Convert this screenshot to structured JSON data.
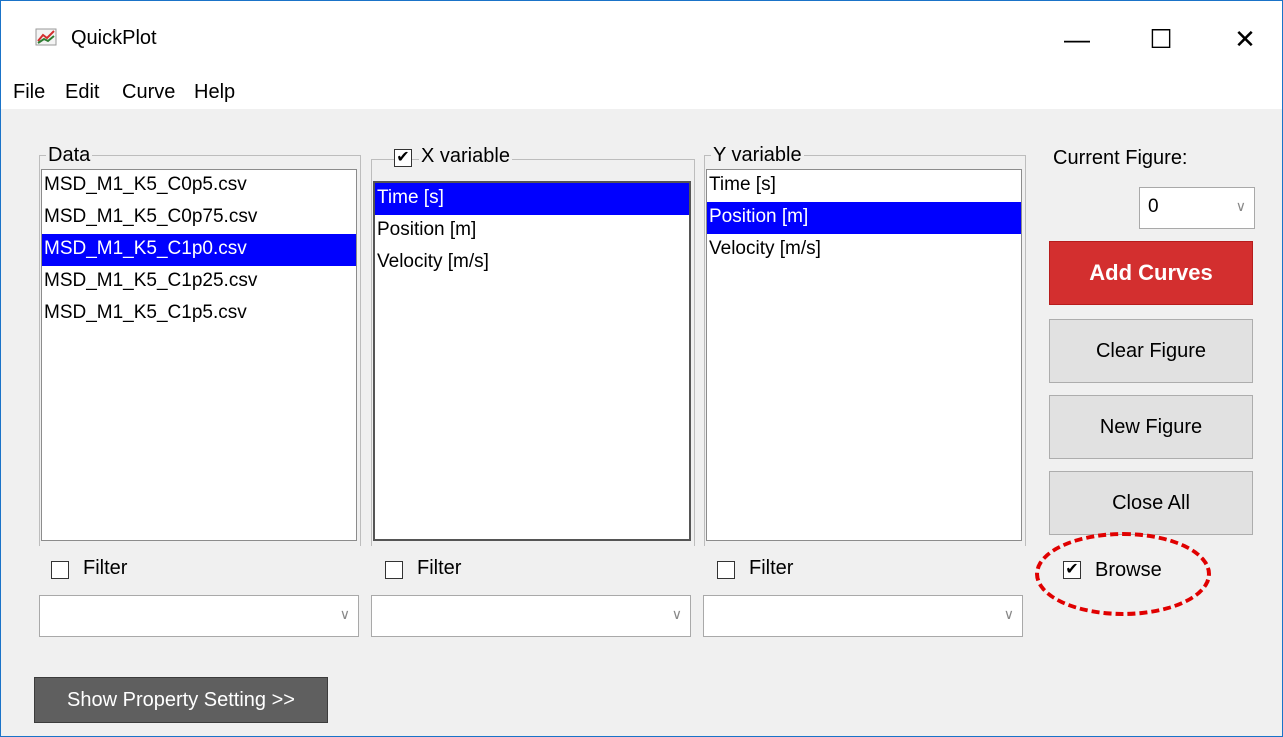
{
  "window": {
    "title": "QuickPlot",
    "controls": {
      "minimize": "—",
      "maximize": "☐",
      "close": "✕"
    }
  },
  "menu": [
    "File",
    "Edit",
    "Curve",
    "Help"
  ],
  "panels": {
    "data": {
      "label": "Data",
      "items": [
        "MSD_M1_K5_C0p5.csv",
        "MSD_M1_K5_C0p75.csv",
        "MSD_M1_K5_C1p0.csv",
        "MSD_M1_K5_C1p25.csv",
        "MSD_M1_K5_C1p5.csv"
      ],
      "selected_index": 2,
      "filter_label": "Filter",
      "filter_checked": false
    },
    "x_variable": {
      "label": "X variable",
      "checked": true,
      "items": [
        "Time [s]",
        "Position [m]",
        "Velocity [m/s]"
      ],
      "selected_index": 0,
      "filter_label": "Filter",
      "filter_checked": false
    },
    "y_variable": {
      "label": "Y variable",
      "items": [
        "Time [s]",
        "Position [m]",
        "Velocity [m/s]"
      ],
      "selected_index": 1,
      "filter_label": "Filter",
      "filter_checked": false
    }
  },
  "right_panel": {
    "current_figure_label": "Current Figure:",
    "current_figure_value": "0",
    "buttons": {
      "add_curves": "Add Curves",
      "clear_figure": "Clear Figure",
      "new_figure": "New Figure",
      "close_all": "Close All"
    },
    "browse_label": "Browse",
    "browse_checked": true
  },
  "footer": {
    "show_property_setting": "Show Property Setting >>"
  },
  "colors": {
    "selection": "#0000ff",
    "primary_button": "#d32f2f",
    "highlight_ring": "#e00000"
  }
}
